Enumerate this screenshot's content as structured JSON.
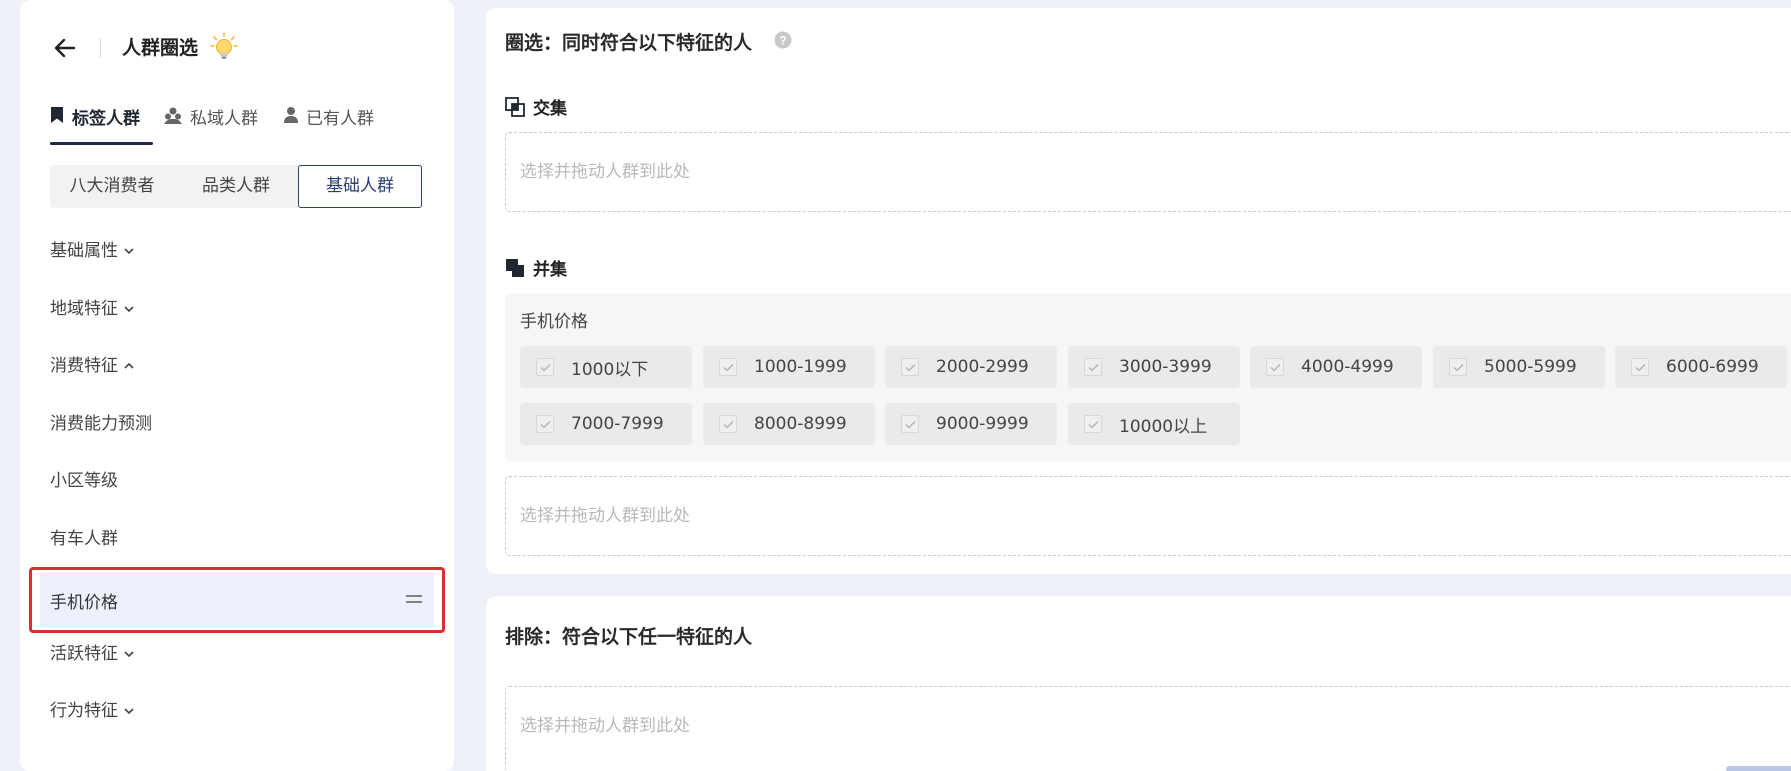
{
  "header": {
    "title": "人群圈选"
  },
  "main_tabs": [
    {
      "label": "标签人群",
      "active": true
    },
    {
      "label": "私域人群",
      "active": false
    },
    {
      "label": "已有人群",
      "active": false
    }
  ],
  "segments": [
    {
      "label": "八大消费者",
      "active": false
    },
    {
      "label": "品类人群",
      "active": false
    },
    {
      "label": "基础人群",
      "active": true
    }
  ],
  "categories": [
    {
      "label": "基础属性",
      "chevron": "down"
    },
    {
      "label": "地域特征",
      "chevron": "down"
    },
    {
      "label": "消费特征",
      "chevron": "up"
    },
    {
      "label": "消费能力预测"
    },
    {
      "label": "小区等级"
    },
    {
      "label": "有车人群"
    },
    {
      "label": "手机价格",
      "selected": true
    },
    {
      "label": "活跃特征",
      "chevron": "down"
    },
    {
      "label": "行为特征",
      "chevron": "down"
    }
  ],
  "main": {
    "select_title": "圈选：同时符合以下特征的人",
    "intersection_label": "交集",
    "union_label": "并集",
    "drop_placeholder": "选择并拖动人群到此处",
    "group": {
      "label": "手机价格",
      "options": [
        "1000以下",
        "1000-1999",
        "2000-2999",
        "3000-3999",
        "4000-4999",
        "5000-5999",
        "6000-6999",
        "7000-7999",
        "8000-8999",
        "9000-9999",
        "10000以上"
      ]
    },
    "exclude_title": "排除：符合以下任一特征的人"
  },
  "colors": {
    "accent": "#2b3f73",
    "highlight": "#d4322e",
    "selected_bg": "#eef1fb"
  }
}
